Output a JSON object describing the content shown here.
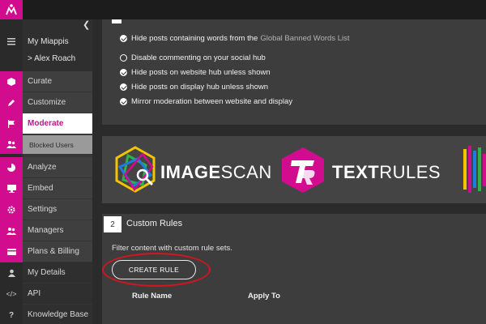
{
  "sidebar": {
    "account_label": "My Miappis",
    "user_label": "> Alex Roach",
    "items": [
      {
        "label": "Curate"
      },
      {
        "label": "Customize"
      },
      {
        "label": "Moderate"
      },
      {
        "label": "Blocked Users"
      },
      {
        "label": "Analyze"
      },
      {
        "label": "Embed"
      },
      {
        "label": "Settings"
      },
      {
        "label": "Managers"
      },
      {
        "label": "Plans & Billing"
      },
      {
        "label": "My Details"
      },
      {
        "label": "API"
      },
      {
        "label": "Knowledge Base"
      }
    ]
  },
  "moderation": {
    "options": [
      {
        "label": "Hide posts containing words from the",
        "link": "Global Banned Words List",
        "checked": true
      },
      {
        "label": "Disable commenting on your social hub",
        "checked": false
      },
      {
        "label": "Hide posts on website hub unless shown",
        "checked": true
      },
      {
        "label": "Hide posts on display hub unless shown",
        "checked": true
      },
      {
        "label": "Mirror moderation between website and display",
        "checked": true
      }
    ]
  },
  "banner": {
    "imagescan": {
      "bold": "IMAGE",
      "rest": "SCAN"
    },
    "textrules": {
      "bold": "TEXT",
      "rest": "RULES"
    }
  },
  "custom_rules": {
    "step": "2",
    "title": "Custom Rules",
    "description": "Filter content with custom rule sets.",
    "button_label": "CREATE RULE",
    "columns": [
      "Rule Name",
      "Apply To"
    ]
  },
  "colors": {
    "brand_magenta": "#d10c8f",
    "highlight_red": "#d4141f"
  },
  "icons": [
    "menu-icon",
    "curate-icon",
    "customize-icon",
    "moderate-icon",
    "users-icon",
    "analyze-icon",
    "embed-icon",
    "settings-icon",
    "managers-icon",
    "billing-icon",
    "user-icon",
    "api-icon",
    "help-icon"
  ]
}
